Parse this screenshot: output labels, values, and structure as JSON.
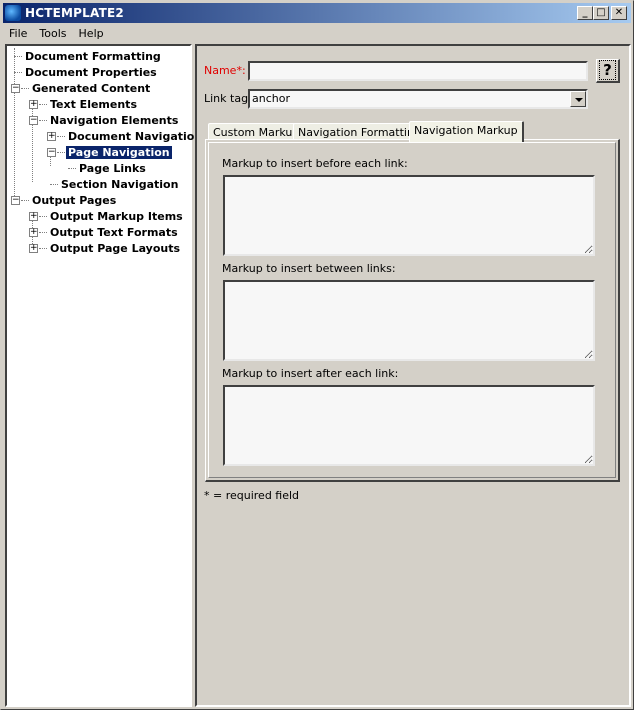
{
  "window": {
    "title": "HCTEMPLATE2",
    "icon": "app-globe-icon",
    "controls": {
      "minimize": "_",
      "maximize": "□",
      "close": "✕"
    }
  },
  "menu": [
    "File",
    "Tools",
    "Help"
  ],
  "tree": [
    {
      "label": "Document Formatting",
      "level": 0,
      "expander": "none",
      "selected": false
    },
    {
      "label": "Document Properties",
      "level": 0,
      "expander": "none",
      "selected": false
    },
    {
      "label": "Generated Content",
      "level": 0,
      "expander": "minus",
      "selected": false
    },
    {
      "label": "Text Elements",
      "level": 1,
      "expander": "plus",
      "selected": false
    },
    {
      "label": "Navigation Elements",
      "level": 1,
      "expander": "minus",
      "selected": false
    },
    {
      "label": "Document Navigation",
      "level": 2,
      "expander": "plus",
      "selected": false
    },
    {
      "label": "Page Navigation",
      "level": 2,
      "expander": "minus",
      "selected": true
    },
    {
      "label": "Page Links",
      "level": 3,
      "expander": "none",
      "selected": false
    },
    {
      "label": "Section Navigation",
      "level": 2,
      "expander": "none",
      "selected": false
    },
    {
      "label": "Output Pages",
      "level": 0,
      "expander": "minus",
      "selected": false
    },
    {
      "label": "Output Markup Items",
      "level": 1,
      "expander": "plus",
      "selected": false
    },
    {
      "label": "Output Text Formats",
      "level": 1,
      "expander": "plus",
      "selected": false
    },
    {
      "label": "Output Page Layouts",
      "level": 1,
      "expander": "plus",
      "selected": false
    }
  ],
  "form": {
    "name_label": "Name*:",
    "name_value": "",
    "help_button": "?",
    "link_tag_label": "Link tag",
    "link_tag_value": "anchor",
    "tabs": [
      {
        "label": "Custom Markup",
        "active": false
      },
      {
        "label": "Navigation Formatting",
        "active": false
      },
      {
        "label": "Navigation Markup",
        "active": true
      }
    ],
    "areas": [
      {
        "label": "Markup to insert before each link:",
        "value": ""
      },
      {
        "label": "Markup to insert between links:",
        "value": ""
      },
      {
        "label": "Markup to insert after each link:",
        "value": ""
      }
    ],
    "footnote": "* = required field"
  },
  "colors": {
    "title_start": "#0a246a",
    "title_end": "#a6caf0",
    "selection": "#0a246a",
    "required": "#e00000",
    "face": "#d4d0c8"
  }
}
